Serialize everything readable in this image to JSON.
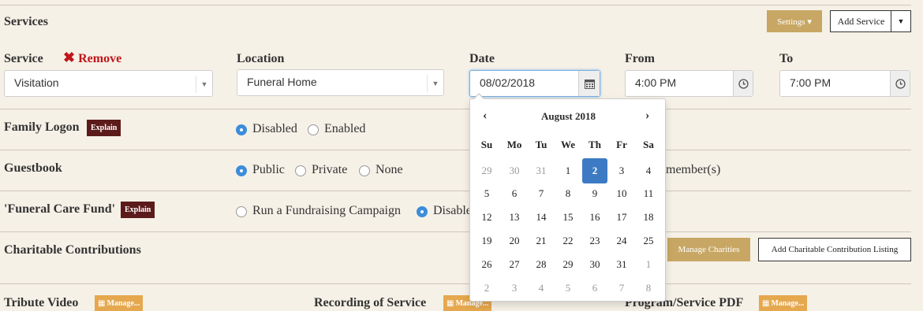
{
  "header": {
    "title": "Services",
    "settings_label": "Settings ▾",
    "add_service_label": "Add Service"
  },
  "service_row": {
    "service_label": "Service",
    "remove_label": "Remove",
    "service_value": "Visitation",
    "location_label": "Location",
    "location_value": "Funeral Home",
    "date_label": "Date",
    "date_value": "08/02/2018",
    "from_label": "From",
    "from_value": "4:00 PM",
    "to_label": "To",
    "to_value": "7:00 PM"
  },
  "family_logon": {
    "label": "Family Logon",
    "explain": "Explain",
    "options": [
      "Disabled",
      "Enabled"
    ],
    "selected": "Disabled"
  },
  "guestbook": {
    "label": "Guestbook",
    "options": [
      "Public",
      "Private",
      "None"
    ],
    "selected": "Public",
    "trailing_text": "member(s)"
  },
  "care_fund": {
    "label": "'Funeral Care Fund'",
    "explain": "Explain",
    "options": [
      "Run a Fundraising Campaign",
      "Disabled"
    ],
    "selected": "Disabled",
    "visible_disabled_text": "Disable"
  },
  "charitable": {
    "label": "Charitable Contributions",
    "manage_label": "Manage Charities",
    "add_label": "Add Charitable Contribution Listing"
  },
  "media": {
    "tribute_label": "Tribute Video",
    "recording_label": "Recording of Service",
    "program_label": "Program/Service PDF",
    "manage_label": "Manage..."
  },
  "datepicker": {
    "month_label": "August 2018",
    "prev": "‹",
    "next": "›",
    "weekdays": [
      "Su",
      "Mo",
      "Tu",
      "We",
      "Th",
      "Fr",
      "Sa"
    ],
    "weeks": [
      [
        "29",
        "30",
        "31",
        "1",
        "2",
        "3",
        "4"
      ],
      [
        "5",
        "6",
        "7",
        "8",
        "9",
        "10",
        "11"
      ],
      [
        "12",
        "13",
        "14",
        "15",
        "16",
        "17",
        "18"
      ],
      [
        "19",
        "20",
        "21",
        "22",
        "23",
        "24",
        "25"
      ],
      [
        "26",
        "27",
        "28",
        "29",
        "30",
        "31",
        "1"
      ],
      [
        "2",
        "3",
        "4",
        "5",
        "6",
        "7",
        "8"
      ]
    ],
    "selected_day": "2"
  },
  "colors": {
    "accent_gold": "#c8a764",
    "badge_maroon": "#5c1b1b",
    "remove_red": "#c0151b",
    "radio_blue": "#3c8ddb",
    "selected_day_blue": "#3c7bc4"
  }
}
